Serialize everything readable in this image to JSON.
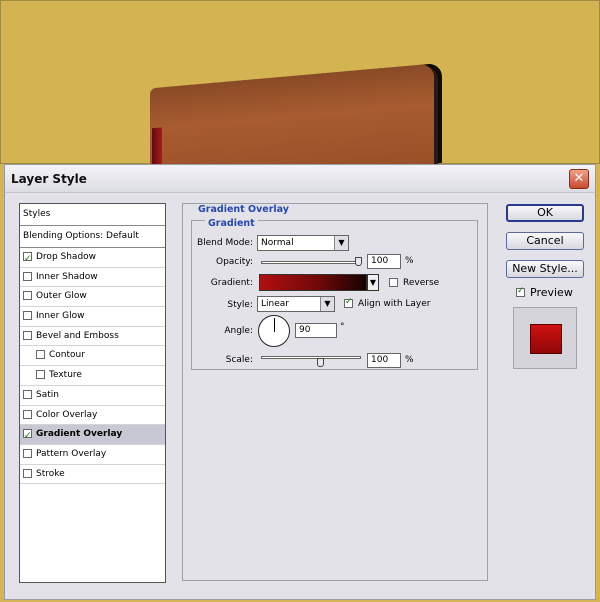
{
  "dialog": {
    "title": "Layer Style",
    "close_glyph": "✕"
  },
  "styles_panel": {
    "header": "Styles",
    "blending": "Blending Options: Default",
    "items": [
      {
        "label": "Drop Shadow",
        "checked": true,
        "indent": false,
        "selected": false
      },
      {
        "label": "Inner Shadow",
        "checked": false,
        "indent": false,
        "selected": false
      },
      {
        "label": "Outer Glow",
        "checked": false,
        "indent": false,
        "selected": false
      },
      {
        "label": "Inner Glow",
        "checked": false,
        "indent": false,
        "selected": false
      },
      {
        "label": "Bevel and Emboss",
        "checked": false,
        "indent": false,
        "selected": false
      },
      {
        "label": "Contour",
        "checked": false,
        "indent": true,
        "selected": false
      },
      {
        "label": "Texture",
        "checked": false,
        "indent": true,
        "selected": false
      },
      {
        "label": "Satin",
        "checked": false,
        "indent": false,
        "selected": false
      },
      {
        "label": "Color Overlay",
        "checked": false,
        "indent": false,
        "selected": false
      },
      {
        "label": "Gradient Overlay",
        "checked": true,
        "indent": false,
        "selected": true
      },
      {
        "label": "Pattern Overlay",
        "checked": false,
        "indent": false,
        "selected": false
      },
      {
        "label": "Stroke",
        "checked": false,
        "indent": false,
        "selected": false
      }
    ]
  },
  "gradient_overlay": {
    "section_title": "Gradient Overlay",
    "group_title": "Gradient",
    "blend_mode_label": "Blend Mode:",
    "blend_mode_value": "Normal",
    "opacity_label": "Opacity:",
    "opacity_value": "100",
    "opacity_level": 1.0,
    "percent": "%",
    "gradient_label": "Gradient:",
    "reverse_label": "Reverse",
    "reverse_checked": false,
    "style_label": "Style:",
    "style_value": "Linear",
    "align_label": "Align with Layer",
    "align_checked": true,
    "angle_label": "Angle:",
    "angle_value": "90",
    "degree": "°",
    "scale_label": "Scale:",
    "scale_value": "100",
    "scale_level": 0.6
  },
  "buttons": {
    "ok": "OK",
    "cancel": "Cancel",
    "new_style": "New Style...",
    "preview_label": "Preview",
    "preview_checked": true
  },
  "colors": {
    "canvas": "#d3b352",
    "gradient_start": "#b01010",
    "gradient_end": "#180202",
    "accent": "#2848b0"
  }
}
